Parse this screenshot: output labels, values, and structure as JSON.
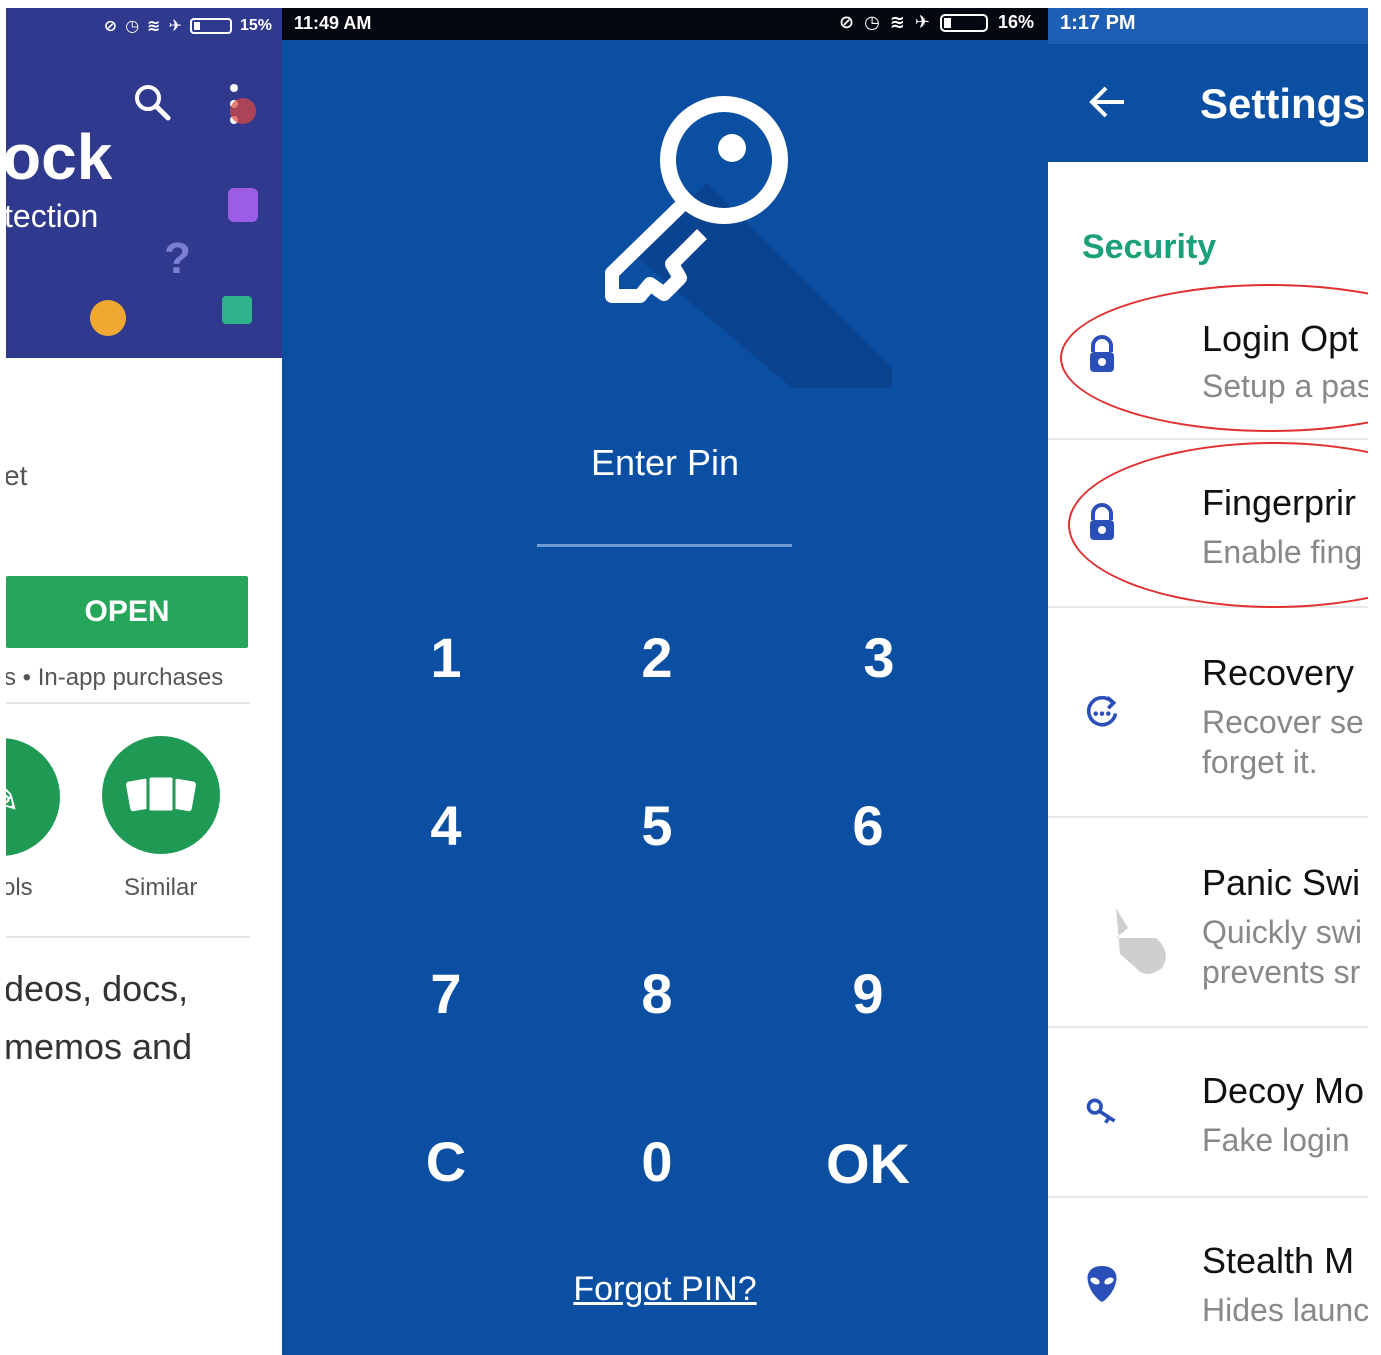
{
  "playstore": {
    "status_battery": "15%",
    "hero_title": "ock",
    "hero_subtitle": "tection",
    "meta_text": "et",
    "open_label": "OPEN",
    "purchases_text": "s • In-app purchases",
    "tools_label": "ols",
    "similar_label": "Similar",
    "desc_line1": "deos, docs,",
    "desc_line2": " memos and"
  },
  "pin": {
    "status_time": "11:49 AM",
    "status_battery": "16%",
    "prompt": "Enter Pin",
    "keys": [
      "1",
      "2",
      "3",
      "4",
      "5",
      "6",
      "7",
      "8",
      "9",
      "C",
      "0",
      "OK"
    ],
    "forgot": "Forgot PIN?",
    "bg_color": "#0b4fa3"
  },
  "settings": {
    "status_time": "1:17 PM",
    "title": "Settings",
    "section": "Security",
    "items": [
      {
        "title": "Login Opt",
        "sub1": "Setup a pas",
        "sub2": "",
        "icon": "lock-icon"
      },
      {
        "title": "Fingerprir",
        "sub1": "Enable fing",
        "sub2": "",
        "icon": "lock-icon"
      },
      {
        "title": "Recovery",
        "sub1": "Recover se",
        "sub2": "forget it.",
        "icon": "recovery-icon"
      },
      {
        "title": "Panic Swi",
        "sub1": "Quickly swi",
        "sub2": "prevents sr",
        "icon": "hand-icon"
      },
      {
        "title": "Decoy Mo",
        "sub1": "Fake login",
        "sub2": "",
        "icon": "key-icon"
      },
      {
        "title": "Stealth M",
        "sub1": "Hides launc",
        "sub2": "",
        "icon": "alien-icon"
      }
    ],
    "accent_color": "#1ba07a",
    "highlight_color": "#e03030"
  }
}
